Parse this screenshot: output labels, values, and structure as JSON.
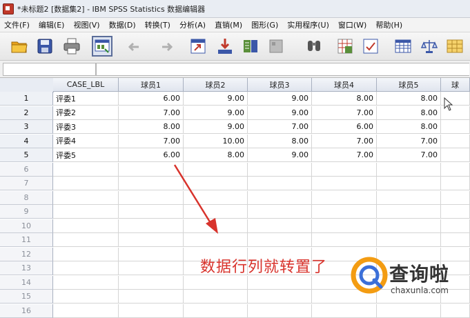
{
  "window": {
    "title": "*未标题2 [数据集2] - IBM SPSS Statistics 数据编辑器"
  },
  "menu": [
    "文件(F)",
    "编辑(E)",
    "视图(V)",
    "数据(D)",
    "转换(T)",
    "分析(A)",
    "直销(M)",
    "图形(G)",
    "实用程序(U)",
    "窗口(W)",
    "帮助(H)"
  ],
  "toolbar": [
    {
      "icon": "open-folder-icon"
    },
    {
      "icon": "save-icon"
    },
    {
      "icon": "print-icon"
    },
    {
      "icon": "recall-dialog-icon"
    },
    {
      "icon": "undo-icon"
    },
    {
      "icon": "redo-icon"
    },
    {
      "icon": "goto-case-icon"
    },
    {
      "icon": "goto-variable-icon"
    },
    {
      "icon": "variables-icon"
    },
    {
      "icon": "run-descriptives-icon"
    },
    {
      "icon": "find-icon"
    },
    {
      "icon": "insert-cases-icon"
    },
    {
      "icon": "insert-variable-icon"
    },
    {
      "icon": "split-file-icon"
    },
    {
      "icon": "weight-cases-icon"
    },
    {
      "icon": "select-cases-icon"
    }
  ],
  "grid": {
    "columns": [
      "CASE_LBL",
      "球员1",
      "球员2",
      "球员3",
      "球员4",
      "球员5",
      "球"
    ],
    "rows": [
      [
        "评委1",
        "6.00",
        "9.00",
        "9.00",
        "8.00",
        "8.00",
        ""
      ],
      [
        "评委2",
        "7.00",
        "9.00",
        "9.00",
        "7.00",
        "8.00",
        ""
      ],
      [
        "评委3",
        "8.00",
        "9.00",
        "7.00",
        "6.00",
        "8.00",
        ""
      ],
      [
        "评委4",
        "7.00",
        "10.00",
        "8.00",
        "7.00",
        "7.00",
        ""
      ],
      [
        "评委5",
        "6.00",
        "8.00",
        "9.00",
        "7.00",
        "7.00",
        ""
      ]
    ],
    "row_numbers": [
      "1",
      "2",
      "3",
      "4",
      "5",
      "6",
      "7",
      "8",
      "9",
      "10",
      "11",
      "12",
      "13",
      "14",
      "15",
      "16"
    ]
  },
  "annotation": "数据行列就转置了",
  "watermark": {
    "brand": "查询啦",
    "url": "chaxunla.com",
    "color": "#f39c12"
  },
  "colors": {
    "annotation": "#d8332c",
    "arrow": "#d8332c"
  }
}
